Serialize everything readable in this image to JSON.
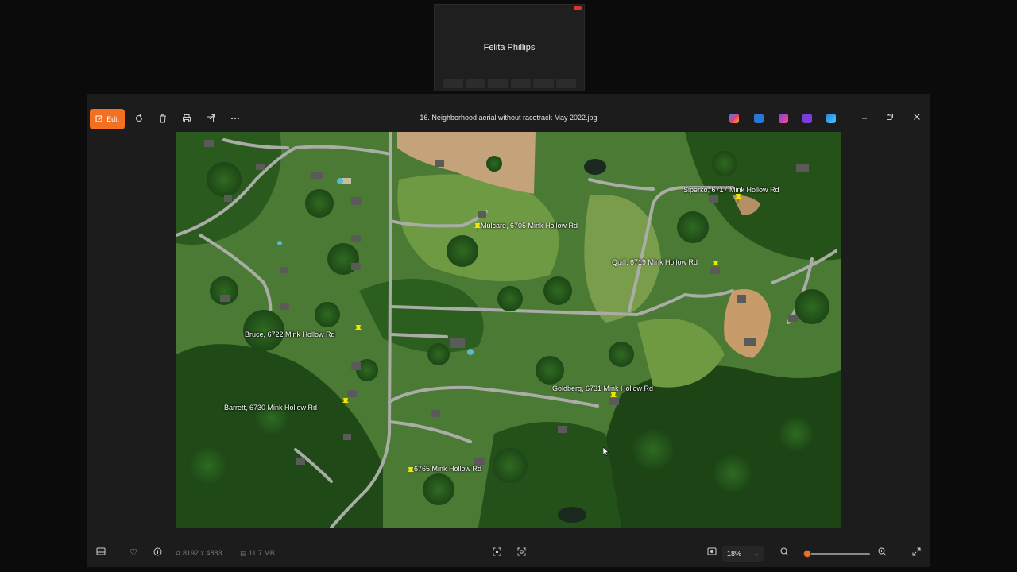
{
  "presenter": {
    "name": "Felita Phillips",
    "toolbar_items": [
      "",
      "",
      "",
      "",
      "",
      ""
    ]
  },
  "window": {
    "title": "16. Neighborhood aerial without racetrack May 2022.jpg",
    "edit_label": "Edit",
    "toolbar_icons": [
      "rotate-icon",
      "delete-icon",
      "print-icon",
      "share-icon",
      "more-icon"
    ],
    "app_icons": [
      "copilot-icon",
      "paint-icon",
      "designer-icon",
      "clipchamp-icon",
      "blur-icon"
    ],
    "accent_color": "#f36f21"
  },
  "map": {
    "labels": [
      {
        "id": "mulcare",
        "text": "Mulcare, 6705 Mink Hollow Rd"
      },
      {
        "id": "siperko",
        "text": "Siperko, 6717 Mink Hollow Rd"
      },
      {
        "id": "quill",
        "text": "Quill, 6719 Mink Hollow Rd"
      },
      {
        "id": "bruce",
        "text": "Bruce, 6722 Mink Hollow Rd"
      },
      {
        "id": "goldberg",
        "text": "Goldberg, 6731 Mink Hollow Rd"
      },
      {
        "id": "barrett",
        "text": "Barrett, 6730 Mink Hollow Rd"
      },
      {
        "id": "unnamed",
        "text": "6765 Mink Hollow Rd"
      }
    ],
    "pin_color": "#f2e600"
  },
  "status": {
    "dimensions": "8192 x 4883",
    "file_size": "11.7 MB",
    "zoom": "18%",
    "zoom_fraction": 0.04
  }
}
